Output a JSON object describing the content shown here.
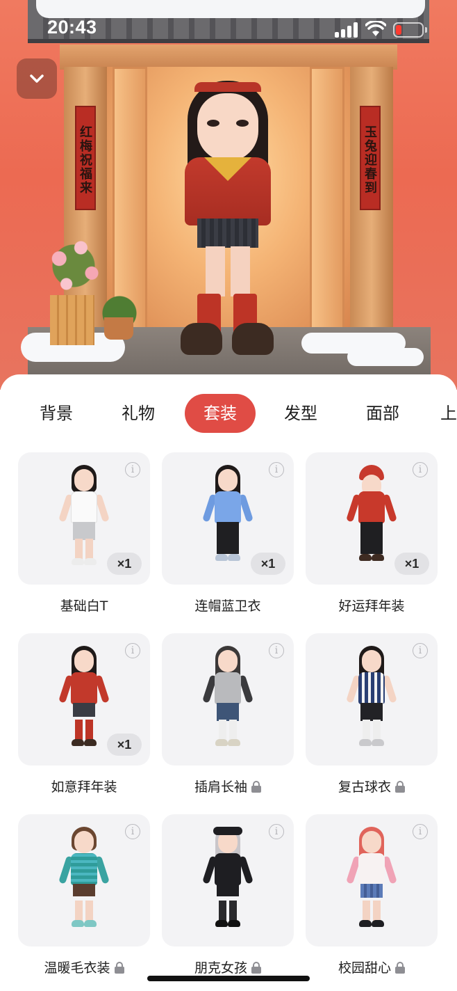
{
  "status_bar": {
    "time": "20:43"
  },
  "scene": {
    "couplet_left": "红梅祝福来",
    "couplet_right": "玉兔迎春到"
  },
  "tabs": [
    {
      "label": "背景",
      "active": false
    },
    {
      "label": "礼物",
      "active": false
    },
    {
      "label": "套装",
      "active": true
    },
    {
      "label": "发型",
      "active": false
    },
    {
      "label": "面部",
      "active": false
    },
    {
      "label": "上",
      "active": false
    }
  ],
  "outfits": [
    {
      "name": "基础白T",
      "quantity": "×1",
      "locked": false
    },
    {
      "name": "连帽蓝卫衣",
      "quantity": "×1",
      "locked": false
    },
    {
      "name": "好运拜年装",
      "quantity": "×1",
      "locked": false
    },
    {
      "name": "如意拜年装",
      "quantity": "×1",
      "locked": false
    },
    {
      "name": "插肩长袖",
      "quantity": "",
      "locked": true
    },
    {
      "name": "复古球衣",
      "quantity": "",
      "locked": true
    },
    {
      "name": "温暖毛衣装",
      "quantity": "",
      "locked": true
    },
    {
      "name": "朋克女孩",
      "quantity": "",
      "locked": true
    },
    {
      "name": "校园甜心",
      "quantity": "",
      "locked": true
    }
  ],
  "icons": {
    "collapse": "chevron-down-icon",
    "info": "info-icon",
    "lock": "lock-icon"
  },
  "colors": {
    "accent": "#e04c45",
    "scene_bg": "#ec6a52",
    "card_bg": "#f3f3f5"
  }
}
